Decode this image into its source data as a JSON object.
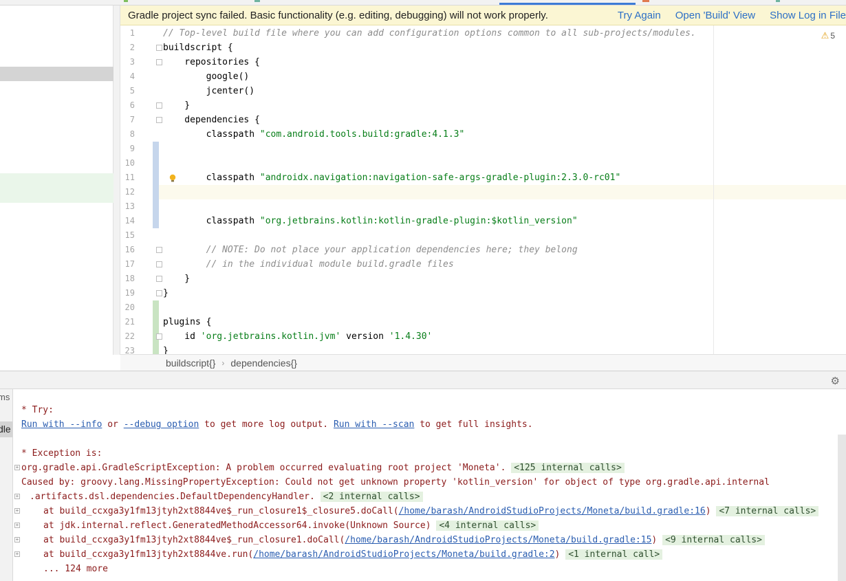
{
  "banner": {
    "message": "Gradle project sync failed. Basic functionality (e.g. editing, debugging) will not work properly.",
    "try_again": "Try Again",
    "open_build": "Open 'Build' View",
    "show_log": "Show Log in File"
  },
  "editor": {
    "line_numbers": [
      "1",
      "2",
      "3",
      "4",
      "5",
      "6",
      "7",
      "8",
      "9",
      "10",
      "11",
      "12",
      "13",
      "14",
      "15",
      "16",
      "17",
      "18",
      "19",
      "20",
      "21",
      "22",
      "23"
    ],
    "warnings_count": "5",
    "lines": [
      "// Top-level build file where you can add configuration options common to all sub-projects/modules.",
      "buildscript {",
      "    repositories {",
      "        google()",
      "        jcenter()",
      "    }",
      "    dependencies {",
      "        classpath",
      "\"com.android.tools.build:gradle:4.1.3\"",
      "",
      "",
      "        classpath",
      "\"androidx.navigation:navigation-safe-args-gradle-plugin:2.3.0-rc01\"",
      "",
      "",
      "        classpath",
      "\"org.jetbrains.kotlin:kotlin-gradle-plugin:$kotlin_version\"",
      "",
      "        // NOTE: Do not place your application dependencies here; they belong",
      "        // in the individual module build.gradle files",
      "    }",
      "}",
      "",
      "plugins {",
      "    id ",
      "'org.jetbrains.kotlin.jvm'",
      " version ",
      "'1.4.30'",
      "}"
    ]
  },
  "breadcrumb": {
    "item1": "buildscript{}",
    "separator": "›",
    "item2": "dependencies{}"
  },
  "tool_window": {
    "side_label_1": "ms",
    "side_label_2": "dle"
  },
  "console": {
    "try_header": "* Try:",
    "run_info": "Run with --info",
    "or": " or ",
    "debug_option": "--debug option",
    "log_output": " to get more log output. ",
    "run_scan": "Run with --scan",
    "full_insights": " to get full insights.",
    "exception_header": "* Exception is:",
    "exc_line": "org.gradle.api.GradleScriptException: A problem occurred evaluating root project 'Moneta'.",
    "exc_internal": "<125 internal calls>",
    "caused_by": "Caused by: groovy.lang.MissingPropertyException: Could not get unknown property 'kotlin_version' for object of type org.gradle.api.internal",
    "caused_cont": ".artifacts.dsl.dependencies.DefaultDependencyHandler.",
    "caused_internal": "<2 internal calls>",
    "at1_prefix": "at build_ccxga3y1fm13jtyh2xt8844ve$_run_closure1$_closure5.doCall(",
    "at1_link": "/home/barash/AndroidStudioProjects/Moneta/build.gradle:16",
    "at1_internal": "<7 internal calls>",
    "at2_prefix": "at jdk.internal.reflect.GeneratedMethodAccessor64.invoke(Unknown Source)",
    "at2_internal": "<4 internal calls>",
    "at3_prefix": "at build_ccxga3y1fm13jtyh2xt8844ve$_run_closure1.doCall(",
    "at3_link": "/home/barash/AndroidStudioProjects/Moneta/build.gradle:15",
    "at3_internal": "<9 internal calls>",
    "at4_prefix": "at build_ccxga3y1fm13jtyh2xt8844ve.run(",
    "at4_link": "/home/barash/AndroidStudioProjects/Moneta/build.gradle:2",
    "at4_internal": "<1 internal call>",
    "close_paren": ")",
    "more": "... 124 more"
  },
  "colors": {
    "banner_bg": "#fbf6d3",
    "link": "#2c6fc6",
    "string": "#067d17",
    "comment": "#8c8c8c",
    "error_text": "#8b1a1a",
    "internal_calls_bg": "#e4f1e0"
  },
  "icons": [
    "warning-icon",
    "lightbulb-icon",
    "gear-icon",
    "fold-icon",
    "expand-icon"
  ]
}
